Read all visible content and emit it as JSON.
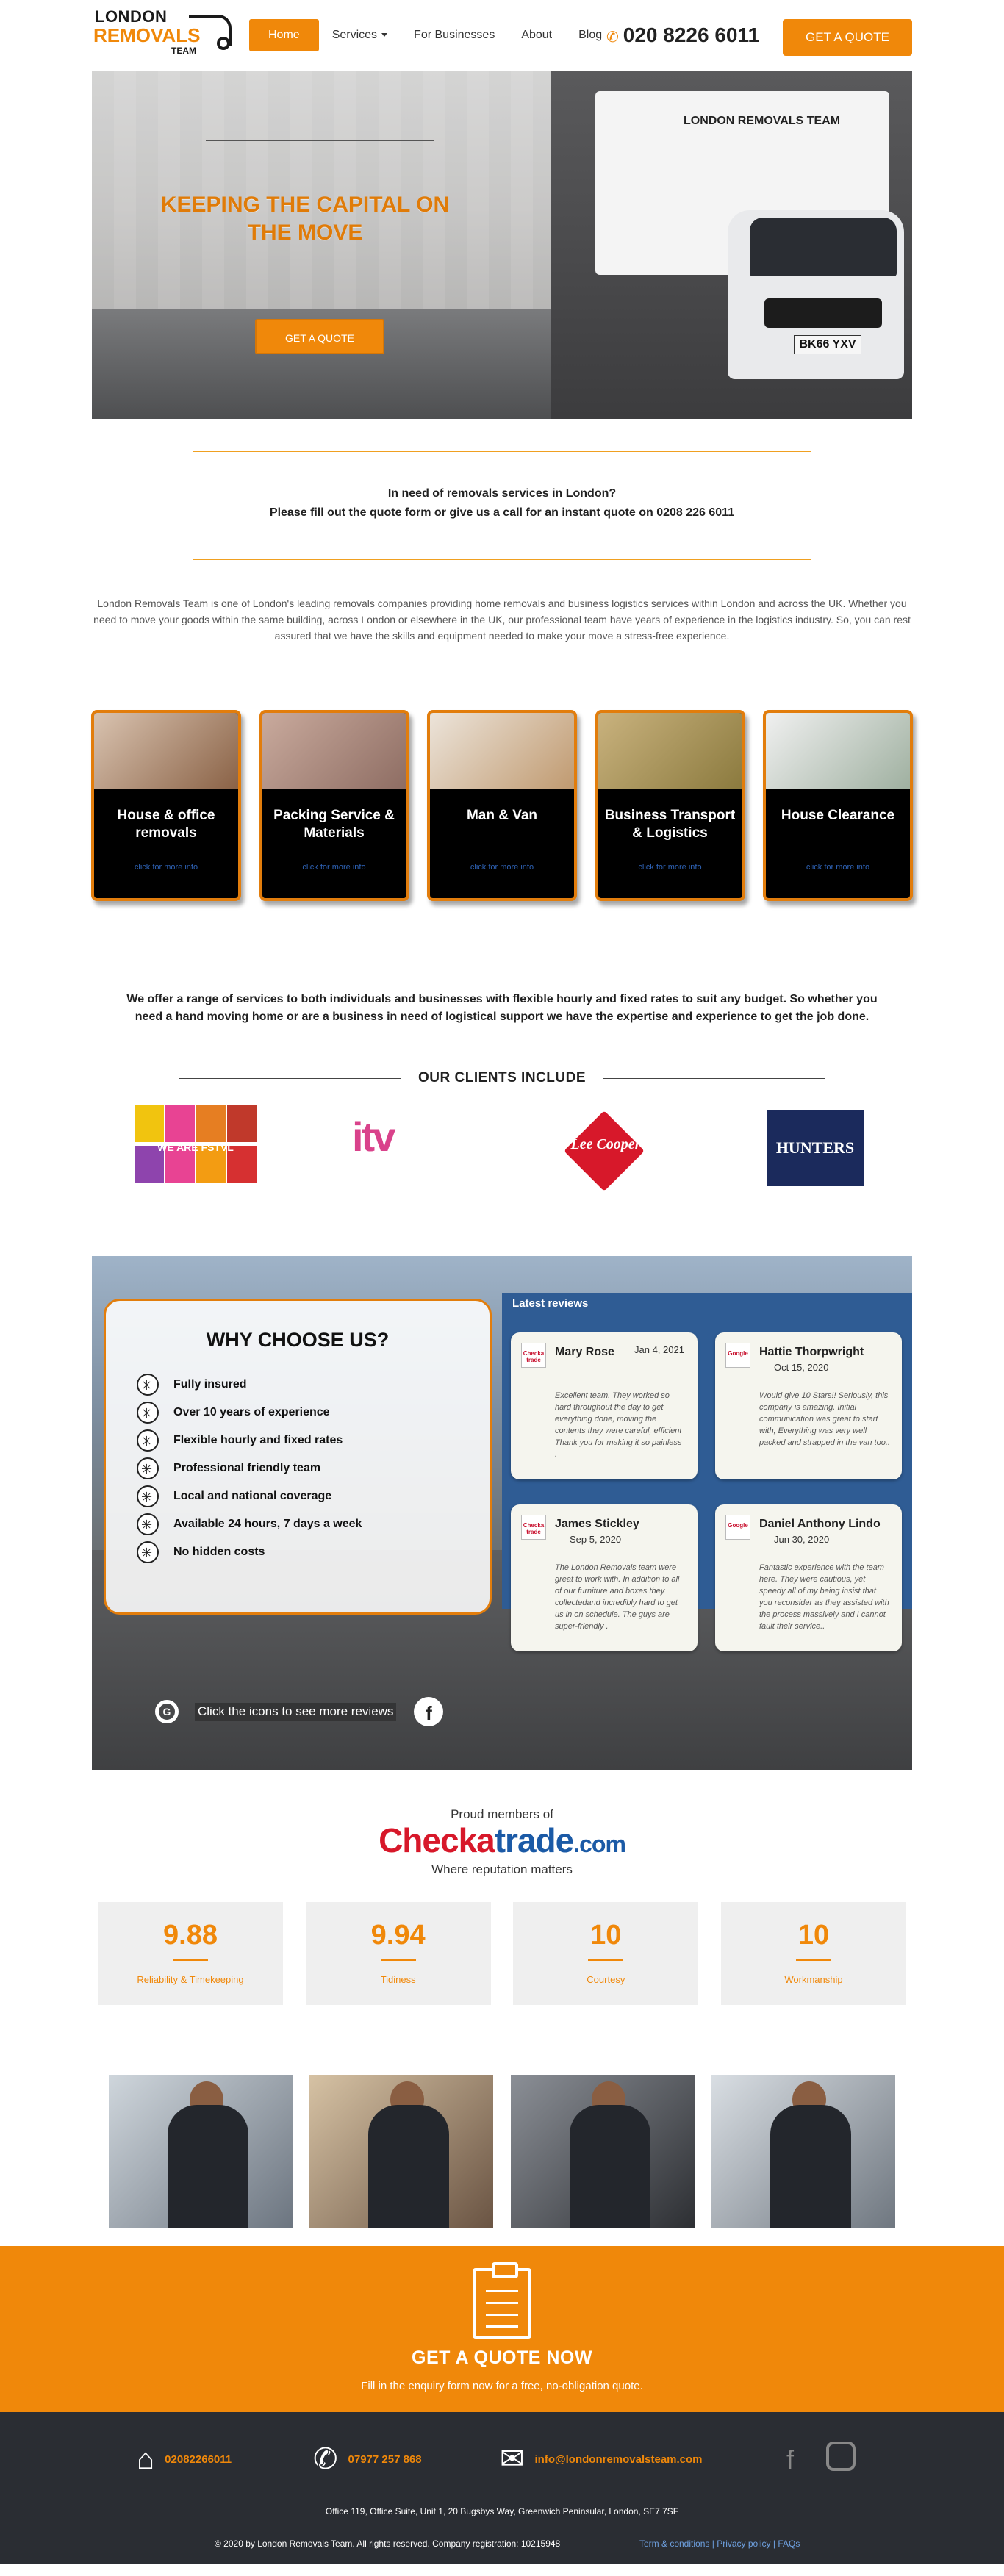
{
  "logo": {
    "line1": "LONDON",
    "line2": "REMOVALS",
    "line3": "TEAM"
  },
  "nav": {
    "home": "Home",
    "services": "Services",
    "business": "For Businesses",
    "about": "About",
    "blog": "Blog"
  },
  "header": {
    "phone": "020 8226 6011",
    "cta": "GET A QUOTE",
    "phone_icon": "phone-icon"
  },
  "hero": {
    "title": "KEEPING THE CAPITAL ON THE MOVE",
    "button": "GET A QUOTE",
    "plate": "BK66 YXV",
    "van_logo": "LONDON REMOVALS TEAM"
  },
  "intro": {
    "line1": "In need of removals services in London?",
    "line2": "Please fill out the quote form or give us a call for an instant quote on 0208 226 6011"
  },
  "about": "London Removals Team is one of London's leading removals companies providing home removals and business logistics services within London and across the UK. Whether you need to move your goods within the same building, across London or elsewhere in the UK, our professional team have years of experience in the logistics industry. So, you can rest assured that we have the skills and equipment needed to make your move a stress-free experience.",
  "services": [
    {
      "title": "House & office removals",
      "more": "click for more info"
    },
    {
      "title": "Packing Service & Materials",
      "more": "click for more info"
    },
    {
      "title": "Man & Van",
      "more": "click for more info"
    },
    {
      "title": "Business Transport & Logistics",
      "more": "click for more info"
    },
    {
      "title": "House Clearance",
      "more": "click for more info"
    }
  ],
  "offer": "We offer a range of services to both individuals and businesses with flexible hourly and fixed rates to suit any budget. So whether you need a hand moving home or are a business in need of logistical support we have the expertise and experience to get the job done.",
  "clients": {
    "heading": "OUR CLIENTS INCLUDE",
    "logos": [
      "WE ARE FSTVL",
      "itv",
      "Lee Cooper",
      "HUNTERS"
    ]
  },
  "why": {
    "heading": "WHY CHOOSE US?",
    "items": [
      "Fully insured",
      "Over 10 years of experience",
      "Flexible hourly and fixed rates",
      "Professional friendly team",
      "Local and national coverage",
      "Available 24 hours, 7 days a week",
      "No hidden costs"
    ],
    "reviews_tag": "Latest reviews",
    "icons_text": "Click the icons to see more reviews"
  },
  "reviews": [
    {
      "name": "Mary Rose",
      "date": "Jan 4, 2021",
      "source": "Checka trade",
      "text": "Excellent team. They worked so hard throughout the day to get everything done, moving the contents they were careful, efficient Thank you for making it so painless ."
    },
    {
      "name": "Hattie Thorpwright",
      "date": "Oct 15, 2020",
      "source": "Google",
      "text": "Would give 10 Stars!! Seriously, this company is amazing. Initial communication was great to start with, Everything was very well packed and strapped in the van too.."
    },
    {
      "name": "James Stickley",
      "date": "Sep 5, 2020",
      "source": "Checka trade",
      "text": "The London Removals team were great to work with. In addition to all of our furniture and boxes they collectedand incredibly hard to get us in on schedule. The guys are super-friendly ."
    },
    {
      "name": "Daniel Anthony Lindo",
      "date": "Jun 30, 2020",
      "source": "Google",
      "text": "Fantastic experience with the team here. They were cautious, yet speedy all of my being insist that you reconsider as they assisted with the process massively and I cannot fault their service.."
    }
  ],
  "checkatrade": {
    "proud": "Proud members of",
    "logo_red": "Checka",
    "logo_blue": "trade",
    "logo_com": ".com",
    "strap": "Where reputation matters",
    "scores": [
      {
        "value": "9.88",
        "label": "Reliability & Timekeeping"
      },
      {
        "value": "9.94",
        "label": "Tidiness"
      },
      {
        "value": "10",
        "label": "Courtesy"
      },
      {
        "value": "10",
        "label": "Workmanship"
      }
    ]
  },
  "quote_band": {
    "title": "GET A QUOTE NOW",
    "sub": "Fill in the enquiry form now for a free, no-obligation quote."
  },
  "footer": {
    "phone1": "02082266011",
    "phone2": "07977 257 868",
    "email": "info@londonremovalsteam.com",
    "address": "Office 119, Office Suite, Unit 1, 20 Bugsbys Way, Greenwich Peninsular, London, SE7 7SF",
    "copyright": "© 2020 by London Removals Team. All rights reserved. Company registration: 10215948",
    "terms": "Term & conditions",
    "privacy": "Privacy policy",
    "faqs": "FAQs",
    "sep": "|"
  },
  "colors": {
    "accent": "#f0880a",
    "dark": "#2a2d33",
    "review_blue": "#2f5c94"
  }
}
